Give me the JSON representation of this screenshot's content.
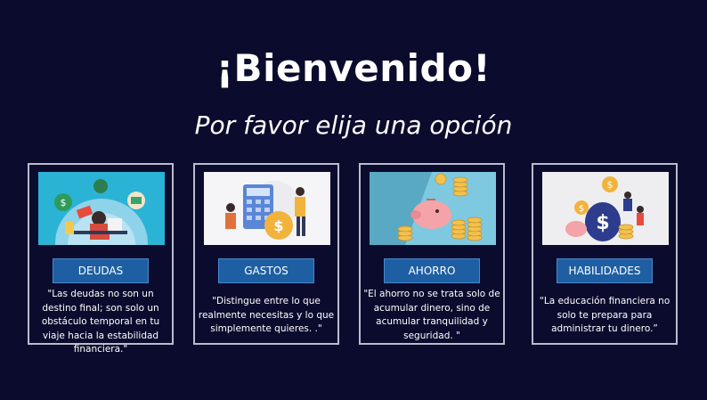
{
  "header": {
    "title": "¡Bienvenido!",
    "subtitle": "Por favor elija una opción"
  },
  "cards": [
    {
      "button_label": "DEUDAS",
      "quote": "\"Las deudas no son un destino final; son solo un obstáculo temporal en tu viaje hacia la estabilidad financiera.\"",
      "image_bg": "#2bb3d6"
    },
    {
      "button_label": "GASTOS",
      "quote": "\"Distingue entre lo que realmente necesitas y lo que simplemente quieres. .\"",
      "image_bg": "#f5f5f7"
    },
    {
      "button_label": "AHORRO",
      "quote": "\"El ahorro no se trata solo de acumular dinero, sino de acumular tranquilidad y seguridad. \"",
      "image_bg": "#7ec9e0"
    },
    {
      "button_label": "HABILIDADES",
      "quote": "“La educación financiera no solo te prepara para administrar tu dinero.”",
      "image_bg": "#eeeef0"
    }
  ],
  "colors": {
    "page_background": "#0b0b2e",
    "button_background": "#1e5fa3",
    "card_border": "#b9bccc"
  }
}
